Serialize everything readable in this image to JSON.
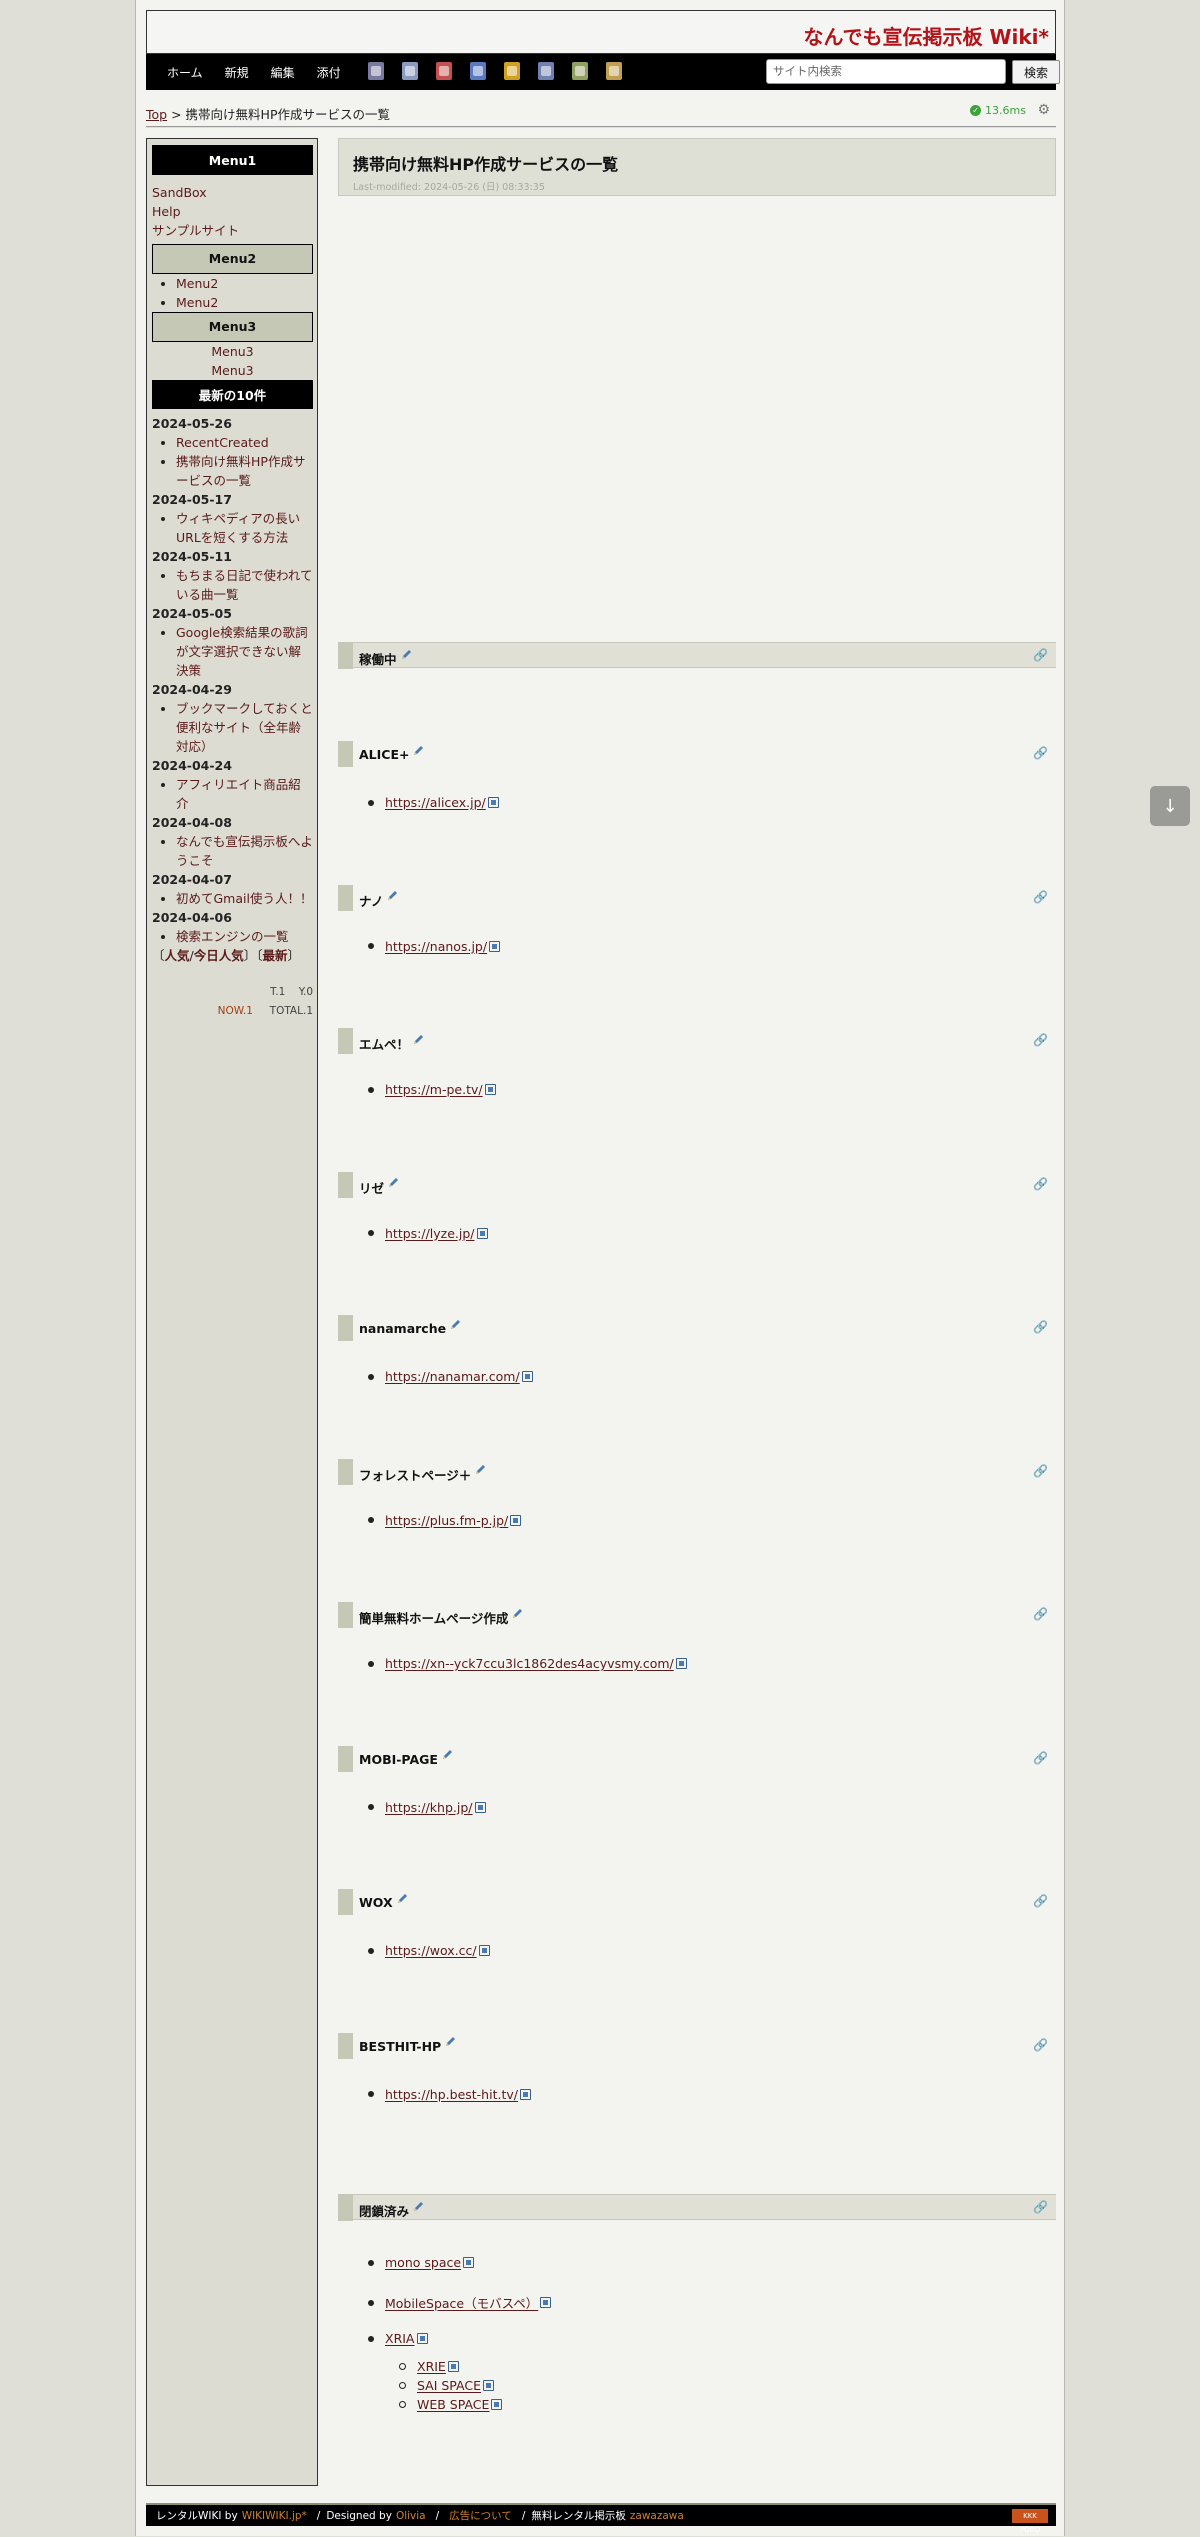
{
  "site": {
    "title": "なんでも宣伝掲示板 Wiki*"
  },
  "nav": {
    "links": [
      "ホーム",
      "新規",
      "編集",
      "添付"
    ],
    "tool_icons": [
      {
        "name": "attach-icon",
        "color": "#7a7aa0"
      },
      {
        "name": "copy-page-icon",
        "color": "#8a9ac0"
      },
      {
        "name": "image-icon",
        "color": "#c65050"
      },
      {
        "name": "page-icon",
        "color": "#5a7ac0"
      },
      {
        "name": "lock-icon",
        "color": "#d0a020"
      },
      {
        "name": "list-icon",
        "color": "#7080b0"
      },
      {
        "name": "history-icon",
        "color": "#90a060"
      },
      {
        "name": "backup-icon",
        "color": "#c0a050"
      }
    ],
    "search_placeholder": "サイト内検索",
    "search_button": "検索"
  },
  "breadcrumb": {
    "top": "Top",
    "separator": ">",
    "current": "携帯向け無料HP作成サービスの一覧"
  },
  "speed": "13.6ms",
  "sidebar": {
    "menu1_title": "Menu1",
    "menu1_links": [
      "SandBox",
      "Help",
      "サンプルサイト"
    ],
    "menu2_title": "Menu2",
    "menu2_items": [
      "Menu2",
      "Menu2"
    ],
    "menu3_title": "Menu3",
    "menu3_items": [
      "Menu3",
      "Menu3"
    ],
    "recent_title": "最新の10件",
    "recent": [
      {
        "date": "2024-05-26",
        "items": [
          "RecentCreated",
          "携帯向け無料HP作成サービスの一覧"
        ]
      },
      {
        "date": "2024-05-17",
        "items": [
          "ウィキペディアの長いURLを短くする方法"
        ]
      },
      {
        "date": "2024-05-11",
        "items": [
          "もちまる日記で使われている曲一覧"
        ]
      },
      {
        "date": "2024-05-05",
        "items": [
          "Google検索結果の歌詞が文字選択できない解決策"
        ]
      },
      {
        "date": "2024-04-29",
        "items": [
          "ブックマークしておくと便利なサイト（全年齢対応）"
        ]
      },
      {
        "date": "2024-04-24",
        "items": [
          "アフィリエイト商品紹介"
        ]
      },
      {
        "date": "2024-04-08",
        "items": [
          "なんでも宣伝掲示板へようこそ"
        ]
      },
      {
        "date": "2024-04-07",
        "items": [
          "初めてGmail使う人！！"
        ]
      },
      {
        "date": "2024-04-06",
        "items": [
          "検索エンジンの一覧"
        ]
      }
    ],
    "rank_links": [
      "〔",
      "人気",
      "/",
      "今日人気",
      "〕〔",
      "最新",
      "〕"
    ],
    "counter": {
      "t_label": "T.",
      "t": "1",
      "y_label": "Y.",
      "y": "0",
      "now_label": "NOW.",
      "now": "1",
      "total_label": "TOTAL.",
      "total": "1"
    }
  },
  "main": {
    "title": "携帯向け無料HP作成サービスの一覧",
    "lastmod": "Last-modified: 2024-05-26 (日) 08:33:35",
    "active_heading": "稼働中",
    "services": [
      {
        "name": "ALICE+",
        "url": "https://alicex.jp/"
      },
      {
        "name": "ナノ",
        "url": "https://nanos.jp/"
      },
      {
        "name": "エムペ！",
        "url": "https://m-pe.tv/"
      },
      {
        "name": "リゼ",
        "url": "https://lyze.jp/"
      },
      {
        "name": "nanamarche",
        "url": "https://nanamar.com/"
      },
      {
        "name": "フォレストページ＋",
        "url": "https://plus.fm-p.jp/"
      },
      {
        "name": "簡単無料ホームページ作成",
        "url": "https://xn--yck7ccu3lc1862des4acyvsmy.com/"
      },
      {
        "name": "MOBI-PAGE",
        "url": "https://khp.jp/"
      },
      {
        "name": "WOX",
        "url": "https://wox.cc/"
      },
      {
        "name": "BESTHIT-HP",
        "url": "https://hp.best-hit.tv/"
      }
    ],
    "closed_heading": "閉鎖済み",
    "closed": [
      "mono space",
      "MobileSpace（モバスペ）",
      "XRIA"
    ],
    "closed_sub": [
      "XRIE",
      "SAI SPACE",
      "WEB SPACE"
    ]
  },
  "footer": {
    "rental": "レンタルWIKI by",
    "wikiwiki": "WIKIWIKI.jp*",
    "designed": "Designed by",
    "designer": "Olivia",
    "ad": "広告について",
    "bbs": "無料レンタル掲示板",
    "zawazawa": "zawazawa",
    "logo": "KKK PORO"
  }
}
